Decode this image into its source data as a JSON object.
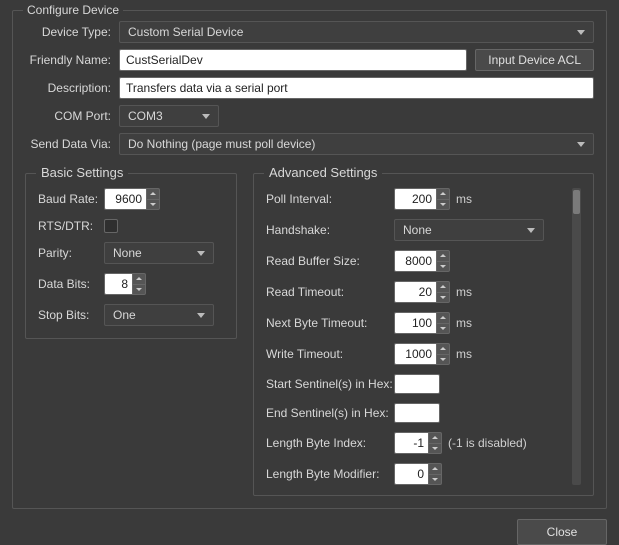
{
  "title": "Configure Device",
  "labels": {
    "deviceType": "Device Type:",
    "friendlyName": "Friendly Name:",
    "description": "Description:",
    "comPort": "COM Port:",
    "sendDataVia": "Send Data Via:",
    "inputDeviceAcl": "Input Device ACL",
    "close": "Close"
  },
  "values": {
    "deviceType": "Custom Serial Device",
    "friendlyName": "CustSerialDev",
    "description": "Transfers data via a serial port",
    "comPort": "COM3",
    "sendDataVia": "Do Nothing (page must poll device)"
  },
  "basic": {
    "legend": "Basic Settings",
    "baudRateLabel": "Baud Rate:",
    "baudRate": "9600",
    "rtsDtrLabel": "RTS/DTR:",
    "parityLabel": "Parity:",
    "parity": "None",
    "dataBitsLabel": "Data Bits:",
    "dataBits": "8",
    "stopBitsLabel": "Stop Bits:",
    "stopBits": "One"
  },
  "advanced": {
    "legend": "Advanced Settings",
    "pollIntervalLabel": "Poll Interval:",
    "pollInterval": "200",
    "ms": "ms",
    "handshakeLabel": "Handshake:",
    "handshake": "None",
    "readBufferSizeLabel": "Read Buffer Size:",
    "readBufferSize": "8000",
    "readTimeoutLabel": "Read Timeout:",
    "readTimeout": "20",
    "nextByteTimeoutLabel": "Next Byte Timeout:",
    "nextByteTimeout": "100",
    "writeTimeoutLabel": "Write Timeout:",
    "writeTimeout": "1000",
    "startSentinelLabel": "Start Sentinel(s) in Hex:",
    "startSentinel": "",
    "endSentinelLabel": "End Sentinel(s) in Hex:",
    "endSentinel": "",
    "lengthByteIndexLabel": "Length Byte Index:",
    "lengthByteIndex": "-1",
    "lengthByteIndexHint": "(-1 is disabled)",
    "lengthByteModifierLabel": "Length Byte Modifier:",
    "lengthByteModifier": "0"
  }
}
